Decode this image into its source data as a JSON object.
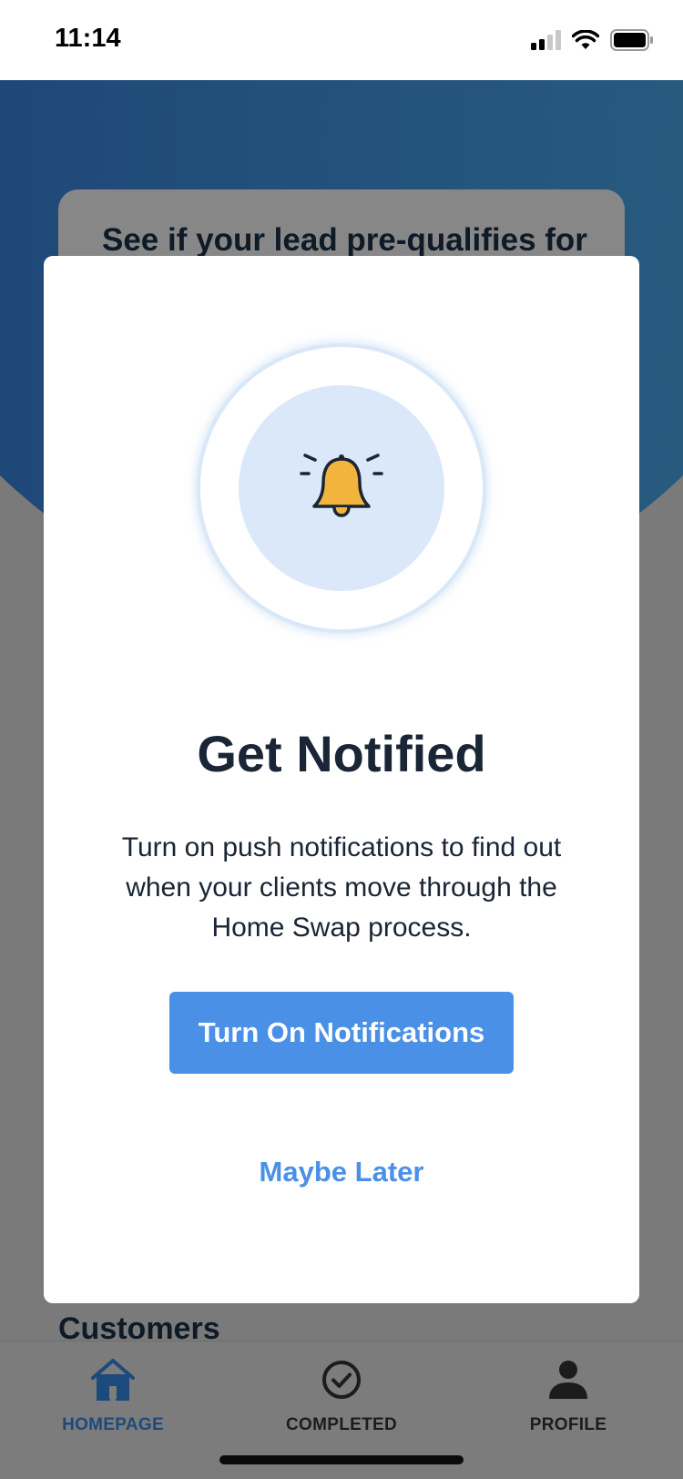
{
  "status_bar": {
    "time": "11:14",
    "icons": [
      "cellular-signal-icon",
      "wifi-icon",
      "battery-icon"
    ]
  },
  "background": {
    "card_title": "See if your lead pre-qualifies for",
    "section_title": "Customers"
  },
  "modal": {
    "icon": "bell-icon",
    "title": "Get Notified",
    "body": "Turn on push notifications to find out when your clients move through the Home Swap process.",
    "primary_button": "Turn On Notifications",
    "secondary_button": "Maybe Later"
  },
  "tab_bar": {
    "items": [
      {
        "label": "HOMEPAGE",
        "icon": "home-icon",
        "active": true
      },
      {
        "label": "COMPLETED",
        "icon": "check-circle-icon",
        "active": false
      },
      {
        "label": "PROFILE",
        "icon": "person-icon",
        "active": false
      }
    ]
  },
  "colors": {
    "primary": "#4a90e6",
    "hero_blue": "#1c4377",
    "bell": "#f2b43c",
    "text_dark": "#1a2535"
  }
}
